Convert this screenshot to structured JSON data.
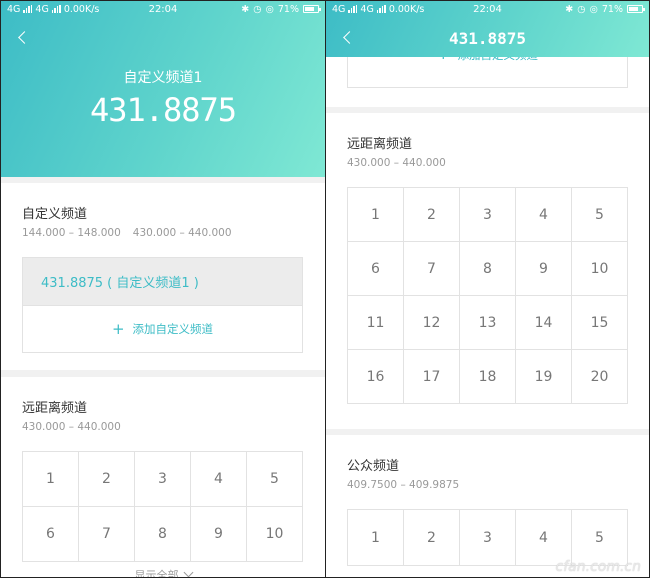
{
  "status": {
    "network_left": "4G",
    "network_right": "4G",
    "speed": "0.00K/s",
    "time": "22:04",
    "battery_pct": "71%",
    "battery_level": 0.71
  },
  "left": {
    "header_sub": "自定义频道1",
    "header_freq": "431.8875",
    "custom": {
      "title": "自定义频道",
      "range1": "144.000 – 148.000",
      "range2": "430.000 – 440.000",
      "selected": "431.8875 ( 自定义频道1 )",
      "add_label": "添加自定义频道"
    },
    "remote": {
      "title": "远距离频道",
      "range": "430.000 – 440.000",
      "cells": [
        "1",
        "2",
        "3",
        "4",
        "5",
        "6",
        "7",
        "8",
        "9",
        "10"
      ],
      "show_all": "显示全部"
    }
  },
  "right": {
    "header_title": "431.8875",
    "add_label": "添加自定义频道",
    "remote": {
      "title": "远距离频道",
      "range": "430.000 – 440.000",
      "cells": [
        "1",
        "2",
        "3",
        "4",
        "5",
        "6",
        "7",
        "8",
        "9",
        "10",
        "11",
        "12",
        "13",
        "14",
        "15",
        "16",
        "17",
        "18",
        "19",
        "20"
      ]
    },
    "public": {
      "title": "公众频道",
      "range": "409.7500 – 409.9875",
      "cells": [
        "1",
        "2",
        "3",
        "4",
        "5"
      ]
    }
  },
  "watermark": "cfan.com.cn",
  "colors": {
    "accent": "#3dbcc6",
    "header_end": "#7fe8d4"
  }
}
